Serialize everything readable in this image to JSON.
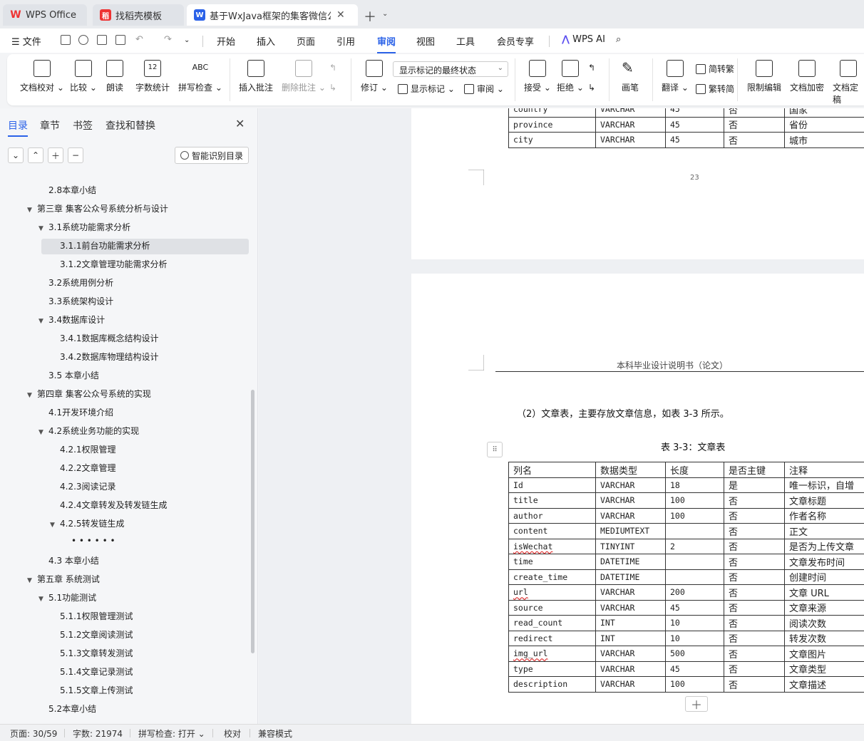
{
  "tabs": [
    {
      "label": "WPS Office",
      "icon": "wps-logo-icon"
    },
    {
      "label": "找稻壳模板",
      "icon": "docer-icon"
    },
    {
      "label": "基于WxJava框架的集客微信公众号",
      "icon": "writer-doc-icon"
    }
  ],
  "menu": {
    "file": "文件",
    "items": [
      "开始",
      "插入",
      "页面",
      "引用",
      "审阅",
      "视图",
      "工具",
      "会员专享"
    ],
    "active": "审阅",
    "wps_ai": "WPS AI"
  },
  "ribbon": {
    "proofread": "文档校对",
    "compare": "比较",
    "read_aloud": "朗读",
    "word_count": "字数统计",
    "spell_check": "拼写检查",
    "spell_icon_text": "ABC",
    "count_icon_text": "12",
    "insert_comment": "插入批注",
    "delete_comment": "删除批注",
    "track_changes": "修订",
    "markup_state": "显示标记的最终状态",
    "show_markup": "显示标记",
    "review_pane": "审阅",
    "accept": "接受",
    "reject": "拒绝",
    "ink": "画笔",
    "translate": "翻译",
    "to_traditional": "简转繁",
    "to_simplified": "繁转简",
    "restrict_edit": "限制编辑",
    "encrypt": "文档加密",
    "finalize": "文档定稿"
  },
  "sidebar": {
    "tabs": [
      "目录",
      "章节",
      "书签",
      "查找和替换"
    ],
    "smart_toc": "智能识别目录",
    "toc": [
      {
        "label": "2.8本章小结",
        "level": 2,
        "arrow": false
      },
      {
        "label": "第三章 集客公众号系统分析与设计",
        "level": 1,
        "arrow": true
      },
      {
        "label": "3.1系统功能需求分析",
        "level": 2,
        "arrow": true
      },
      {
        "label": "3.1.1前台功能需求分析",
        "level": 3,
        "arrow": false,
        "active": true
      },
      {
        "label": "3.1.2文章管理功能需求分析",
        "level": 3,
        "arrow": false
      },
      {
        "label": "3.2系统用例分析",
        "level": 2,
        "arrow": false
      },
      {
        "label": "3.3系统架构设计",
        "level": 2,
        "arrow": false
      },
      {
        "label": "3.4数据库设计",
        "level": 2,
        "arrow": true
      },
      {
        "label": "3.4.1数据库概念结构设计",
        "level": 3,
        "arrow": false
      },
      {
        "label": "3.4.2数据库物理结构设计",
        "level": 3,
        "arrow": false
      },
      {
        "label": "3.5 本章小结",
        "level": 2,
        "arrow": false
      },
      {
        "label": "第四章 集客公众号系统的实现",
        "level": 1,
        "arrow": true
      },
      {
        "label": "4.1开发环境介绍",
        "level": 2,
        "arrow": false
      },
      {
        "label": "4.2系统业务功能的实现",
        "level": 2,
        "arrow": true
      },
      {
        "label": "4.2.1权限管理",
        "level": 3,
        "arrow": false
      },
      {
        "label": "4.2.2文章管理",
        "level": 3,
        "arrow": false
      },
      {
        "label": "4.2.3阅读记录",
        "level": 3,
        "arrow": false
      },
      {
        "label": "4.2.4文章转发及转发链生成",
        "level": 3,
        "arrow": false
      },
      {
        "label": "4.2.5转发链生成",
        "level": 3,
        "arrow": true
      },
      {
        "label": "• • • • • •",
        "level": 4,
        "arrow": false
      },
      {
        "label": "4.3 本章小结",
        "level": 2,
        "arrow": false
      },
      {
        "label": "第五章 系统测试",
        "level": 1,
        "arrow": true
      },
      {
        "label": "5.1功能测试",
        "level": 2,
        "arrow": true
      },
      {
        "label": "5.1.1权限管理测试",
        "level": 3,
        "arrow": false
      },
      {
        "label": "5.1.2文章阅读测试",
        "level": 3,
        "arrow": false
      },
      {
        "label": "5.1.3文章转发测试",
        "level": 3,
        "arrow": false
      },
      {
        "label": "5.1.4文章记录测试",
        "level": 3,
        "arrow": false
      },
      {
        "label": "5.1.5文章上传测试",
        "level": 3,
        "arrow": false
      },
      {
        "label": "5.2本章小结",
        "level": 2,
        "arrow": false
      }
    ]
  },
  "document": {
    "page1": {
      "rows": [
        [
          "country",
          "VARCHAR",
          "45",
          "否",
          "国家"
        ],
        [
          "province",
          "VARCHAR",
          "45",
          "否",
          "省份"
        ],
        [
          "city",
          "VARCHAR",
          "45",
          "否",
          "城市"
        ]
      ],
      "page_number": "23"
    },
    "page2": {
      "header": "本科毕业设计说明书（论文）",
      "paragraph": "（2）文章表，主要存放文章信息，如表 3-3 所示。",
      "caption": "表 3-3：文章表",
      "columns": [
        "列名",
        "数据类型",
        "长度",
        "是否主键",
        "注释"
      ],
      "rows": [
        [
          "Id",
          "VARCHAR",
          "18",
          "是",
          "唯一标识，自增"
        ],
        [
          "title",
          "VARCHAR",
          "100",
          "否",
          "文章标题"
        ],
        [
          "author",
          "VARCHAR",
          "100",
          "否",
          "作者名称"
        ],
        [
          "content",
          "MEDIUMTEXT",
          "",
          "否",
          "正文"
        ],
        [
          "isWechat",
          "TINYINT",
          "2",
          "否",
          "是否为上传文章"
        ],
        [
          "time",
          "DATETIME",
          "",
          "否",
          "文章发布时间"
        ],
        [
          "create_time",
          "DATETIME",
          "",
          "否",
          "创建时间"
        ],
        [
          "url",
          "VARCHAR",
          "200",
          "否",
          "文章 URL"
        ],
        [
          "source",
          "VARCHAR",
          "45",
          "否",
          "文章来源"
        ],
        [
          "read_count",
          "INT",
          "10",
          "否",
          "阅读次数"
        ],
        [
          "redirect",
          "INT",
          "10",
          "否",
          "转发次数"
        ],
        [
          "img_url",
          "VARCHAR",
          "500",
          "否",
          "文章图片"
        ],
        [
          "type",
          "VARCHAR",
          "45",
          "否",
          "文章类型"
        ],
        [
          "description",
          "VARCHAR",
          "100",
          "否",
          "文章描述"
        ]
      ],
      "misspelled": [
        "isWechat",
        "url",
        "img_url"
      ]
    }
  },
  "status": {
    "page": "页面: 30/59",
    "words": "字数: 21974",
    "spell": "拼写检查: 打开",
    "proof": "校对",
    "compat": "兼容模式"
  }
}
